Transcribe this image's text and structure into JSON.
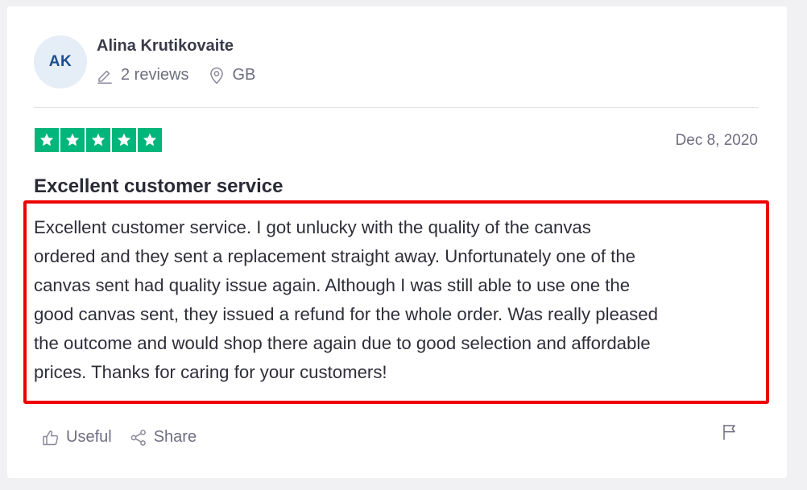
{
  "reviewer": {
    "initials": "AK",
    "name": "Alina Krutikovaite",
    "reviews_count": "2 reviews",
    "country": "GB"
  },
  "review": {
    "rating": 5,
    "rating_max": 5,
    "date": "Dec 8, 2020",
    "title": "Excellent customer service",
    "body_lines": [
      "Excellent customer service. I got unlucky with the quality of the canvas",
      "ordered and they sent a replacement straight away. Unfortunately one of the",
      "canvas sent had quality issue again. Although I was still able to use one the",
      "good canvas sent, they issued a refund for the whole order. Was really pleased",
      "the outcome and would shop there again due to good selection and affordable",
      "prices. Thanks for caring for your customers!"
    ]
  },
  "actions": {
    "useful_label": "Useful",
    "share_label": "Share"
  },
  "icons": {
    "reviews": "pencil-icon",
    "location": "location-pin-icon",
    "star": "star-icon",
    "useful": "thumbs-up-icon",
    "share": "share-icon",
    "report": "flag-icon"
  },
  "colors": {
    "star_fill": "#00b67a",
    "highlight_border": "#ee0000",
    "avatar_bg": "#e5edf7",
    "avatar_text": "#1c4e8a"
  }
}
